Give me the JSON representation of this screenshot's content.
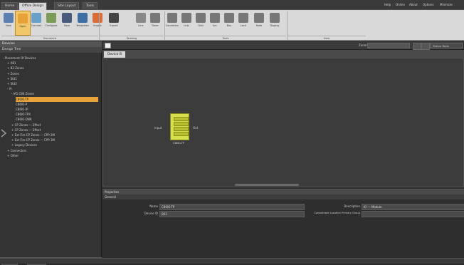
{
  "tabs": [
    {
      "label": "Home"
    },
    {
      "label": "Office Design",
      "active": true
    },
    {
      "label": "Site Layout"
    },
    {
      "label": "Tools"
    }
  ],
  "window_buttons": [
    "Help",
    "Online",
    "About",
    "Options",
    "Minimize"
  ],
  "ribbon": {
    "buttons": [
      {
        "label": "New",
        "color": "#5a7fb0"
      },
      {
        "label": "Open",
        "color": "#e9a23a",
        "active": true
      },
      {
        "label": "Connect",
        "color": "#6aa0c8"
      },
      {
        "label": "Configure",
        "color": "#7c9a5a"
      },
      {
        "label": "Save",
        "color": "#4a5a7a"
      },
      {
        "label": "Templates",
        "color": "#3d6fa5"
      },
      {
        "label": "Import",
        "color": "#d96d3a"
      },
      {
        "label": "Export",
        "color": "#444"
      },
      {
        "label": "Line",
        "color": "#888"
      },
      {
        "label": "Timer",
        "color": "#777"
      },
      {
        "label": "Connector",
        "color": "#777"
      },
      {
        "label": "Link",
        "color": "#777"
      },
      {
        "label": "Grid",
        "color": "#777"
      },
      {
        "label": "Arc",
        "color": "#777"
      },
      {
        "label": "Bus",
        "color": "#777"
      },
      {
        "label": "Lock",
        "color": "#777"
      },
      {
        "label": "Note",
        "color": "#777"
      },
      {
        "label": "Display",
        "color": "#777"
      }
    ],
    "groups": [
      {
        "label": "Document"
      },
      {
        "label": "Drawing"
      },
      {
        "label": "Tools"
      },
      {
        "label": "View"
      }
    ]
  },
  "left_panel": {
    "title": "Devices",
    "subtitle": "Design Tree",
    "tree": [
      {
        "label": "- Placement Of Devices",
        "indent": 0
      },
      {
        "label": "+ AB1",
        "indent": 1
      },
      {
        "label": "+ B2 Zones",
        "indent": 1
      },
      {
        "label": "+ Zones",
        "indent": 1
      },
      {
        "label": "+ Std1",
        "indent": 1
      },
      {
        "label": "+ Std2",
        "indent": 1
      },
      {
        "label": "- IA",
        "indent": 1
      },
      {
        "label": "- IA5 C86 Zones",
        "indent": 2
      },
      {
        "label": "C86IO-TP",
        "indent": 3,
        "selected": true
      },
      {
        "label": "C86IO-P",
        "indent": 3
      },
      {
        "label": "C86IO-IP",
        "indent": 3
      },
      {
        "label": "C86IO-TPX",
        "indent": 3
      },
      {
        "label": "C86IO-DNR",
        "indent": 3
      },
      {
        "label": "+ CP Zones — Effect",
        "indent": 2
      },
      {
        "label": "+ CP Zones — Effect",
        "indent": 2
      },
      {
        "label": "+ Ext Fire CP Zones — CPP 2M",
        "indent": 2
      },
      {
        "label": "+ Ext Fire CP Zones — CPP 3M",
        "indent": 2
      },
      {
        "label": "+ Legacy Devices",
        "indent": 2
      },
      {
        "label": "+ Connectors",
        "indent": 1
      },
      {
        "label": "+ Other",
        "indent": 1
      }
    ],
    "bottom_tabs": [
      "Devices",
      "Properties"
    ]
  },
  "toolbar2": {
    "zoom_label": "Zoom",
    "right_label": "Status Tools"
  },
  "document_tab": "Device B",
  "canvas": {
    "device_label": "C86IO-TP",
    "left_label": "Input",
    "right_label": "Out"
  },
  "properties": {
    "title": "Properties",
    "subtitle": "General",
    "fields": [
      {
        "label": "Name",
        "value": "C86IO-TP"
      },
      {
        "label": "Device ID",
        "value": "001"
      }
    ],
    "right_fields": [
      {
        "label": "Description",
        "value": "IO — Module"
      },
      {
        "label": "Consolidate Location Primary Group",
        "value": ""
      }
    ]
  },
  "colors": {
    "accent_orange": "#e8a33b",
    "device_yellow": "#d6e04a"
  }
}
